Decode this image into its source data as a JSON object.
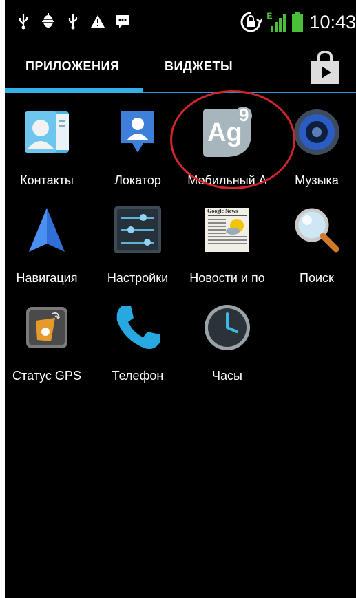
{
  "status_bar": {
    "icons_left": [
      "usb-icon",
      "android-debug-icon",
      "usb-icon",
      "warning-icon",
      "message-icon"
    ],
    "icons_right": [
      "screen-lock-rotation-icon",
      "signal-edge-icon",
      "battery-icon"
    ],
    "network_type": "E",
    "time": "10:43"
  },
  "tabs": [
    {
      "label": "ПРИЛОЖЕНИЯ",
      "selected": true
    },
    {
      "label": "ВИДЖЕТЫ",
      "selected": false
    }
  ],
  "store_icon": "play-store-icon",
  "apps": [
    {
      "label": "Контакты",
      "icon": "contacts-icon"
    },
    {
      "label": "Локатор",
      "icon": "latitude-icon"
    },
    {
      "label": "Мобильный А",
      "icon": "ag9-icon",
      "icon_text": "Ag",
      "icon_sup": "9"
    },
    {
      "label": "Музыка",
      "icon": "music-speaker-icon"
    },
    {
      "label": "Навигация",
      "icon": "navigation-icon"
    },
    {
      "label": "Настройки",
      "icon": "settings-icon"
    },
    {
      "label": "Новости и по",
      "icon": "google-news-icon",
      "icon_text": "Google News"
    },
    {
      "label": "Поиск",
      "icon": "search-icon"
    },
    {
      "label": "Статус GPS",
      "icon": "gps-status-icon"
    },
    {
      "label": "Телефон",
      "icon": "phone-icon"
    },
    {
      "label": "Часы",
      "icon": "clock-icon"
    }
  ],
  "highlight_color": "#d0262b",
  "accent_color": "#33b0e5"
}
